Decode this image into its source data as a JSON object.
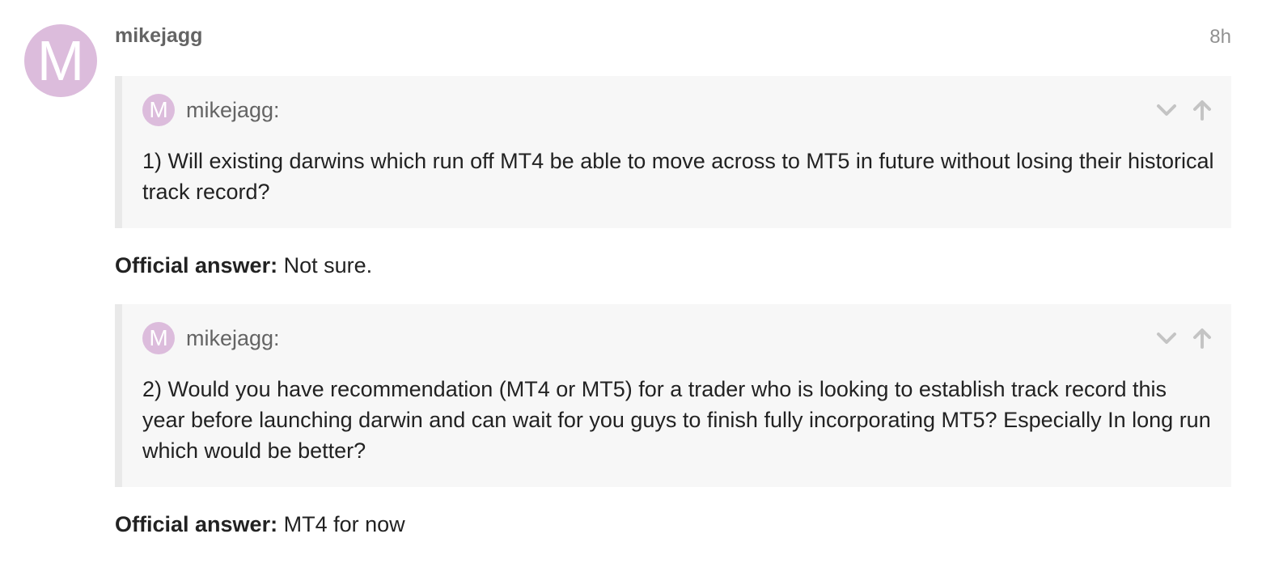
{
  "post": {
    "avatar_letter": "M",
    "username": "mikejagg",
    "time": "8h",
    "avatar_color": "#dcbcdc"
  },
  "quotes": [
    {
      "avatar_letter": "M",
      "author": "mikejagg:",
      "text": "1) Will existing darwins which run off MT4 be able to move across to MT5 in future without losing their historical track record?"
    },
    {
      "avatar_letter": "M",
      "author": "mikejagg:",
      "text": "2) Would you have recommendation (MT4 or MT5) for a trader who is looking to establish track record this year before launching darwin and can wait for you guys to finish fully incorporating MT5? Especially In long run which would be better?"
    }
  ],
  "answers": [
    {
      "label": "Official answer:",
      "text": " Not sure."
    },
    {
      "label": "Official answer:",
      "text": " MT4 for now"
    }
  ],
  "icons": {
    "expand": "chevron-down-icon",
    "jump": "arrow-up-icon"
  }
}
